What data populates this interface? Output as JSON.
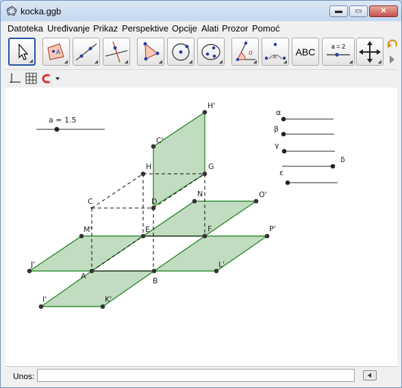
{
  "window": {
    "title": "kocka.ggb",
    "minimize_label": "▬",
    "maximize_label": "▭",
    "close_label": "✕"
  },
  "menu": [
    "Datoteka",
    "Uređivanje",
    "Prikaz",
    "Perspektive",
    "Opcije",
    "Alati",
    "Prozor",
    "Pomoć"
  ],
  "toolbar": {
    "tools": [
      {
        "name": "move-tool",
        "icon": "arrow-cursor-icon",
        "active": true
      },
      {
        "name": "polygon-plane-tool",
        "icon": "plane-A-icon"
      },
      {
        "name": "line-tool",
        "icon": "line-through-points-icon"
      },
      {
        "name": "perpendicular-tool",
        "icon": "perpendicular-line-icon"
      },
      {
        "name": "polygon-tool",
        "icon": "triangle-icon"
      },
      {
        "name": "circle-tool",
        "icon": "circle-center-point-icon"
      },
      {
        "name": "conic-tool",
        "icon": "ellipse-icon"
      },
      {
        "name": "angle-tool",
        "icon": "angle-alpha-icon"
      },
      {
        "name": "reflect-tool",
        "icon": "reflect-about-point-icon"
      },
      {
        "name": "text-tool",
        "icon": "text-icon",
        "text": "ABC"
      },
      {
        "name": "slider-tool",
        "icon": "slider-icon",
        "text": "a = 2"
      },
      {
        "name": "move-view-tool",
        "icon": "move-graphics-view-icon"
      }
    ]
  },
  "stylebar": {
    "icons": [
      "axes-icon",
      "grid-icon",
      "magnet-icon",
      "chevron-down-icon"
    ]
  },
  "graphics": {
    "slider_a": {
      "label": "a = 1.5",
      "value": 1.5
    },
    "angle_sliders": [
      "α",
      "β",
      "γ",
      "δ",
      "ε"
    ],
    "colors": {
      "face_fill": "#c2dcc1",
      "face_stroke": "#2e8b2e",
      "point": "#333333",
      "dashed": "#000000"
    },
    "points": {
      "A": "A",
      "B": "B",
      "C": "C",
      "D": "D",
      "E": "E",
      "F": "F",
      "G": "G",
      "H": "H",
      "Hp": "H'",
      "Cp": "C'",
      "N": "N",
      "Op": "O'",
      "Mp": "M'",
      "Pp": "P'",
      "Jp": "J'",
      "Lp": "L'",
      "Ip": "I'",
      "Kp": "K'"
    }
  },
  "input": {
    "label": "Unos:",
    "value": "",
    "placeholder": ""
  }
}
